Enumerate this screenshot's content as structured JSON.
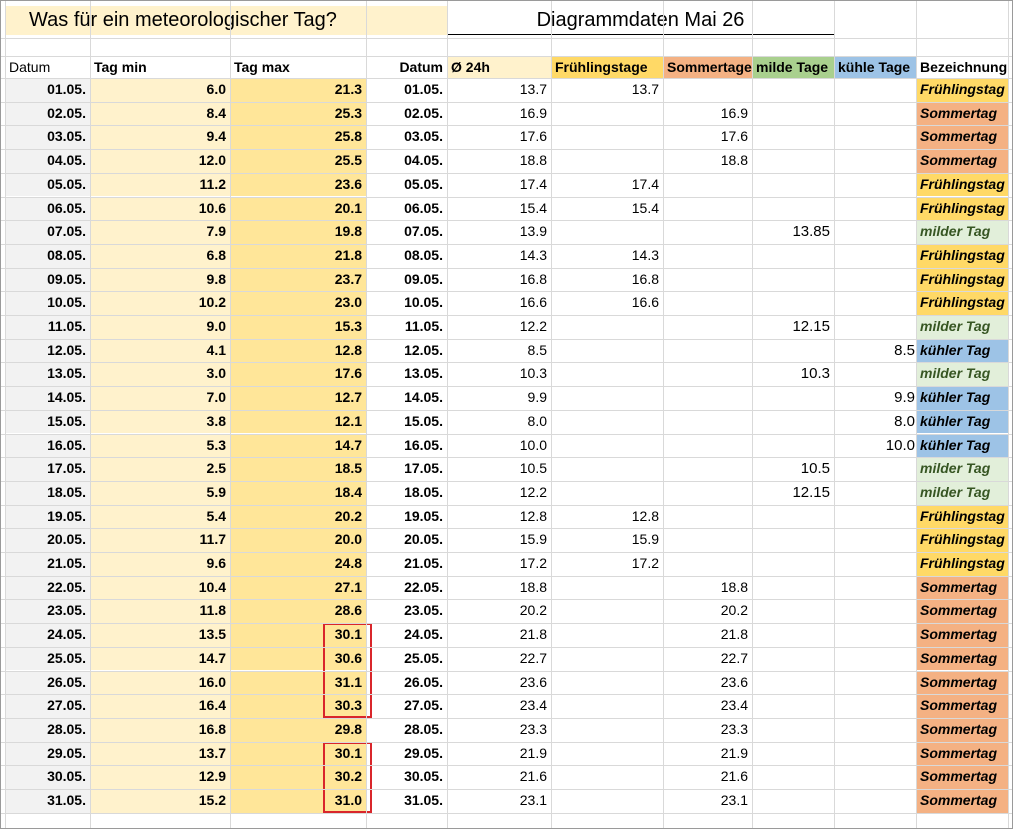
{
  "titles": {
    "left": "Was für ein meteorologischer Tag?",
    "right": "Diagrammdaten Mai 26"
  },
  "headers": {
    "datum": "Datum",
    "tag_min": "Tag min",
    "tag_max": "Tag max",
    "datum2": "Datum",
    "avg24": "Ø 24h",
    "fruehling": "Frühlingstage",
    "sommer": "Sommertage",
    "milde": "milde Tage",
    "kuehle": "kühle Tage",
    "bezeichnung": "Bezeichnung"
  },
  "colors": {
    "light_yellow": "#fff2cc",
    "tag_max_fill": "#ffe699",
    "light_gray": "#f2f2f2",
    "fruehling": "#ffd966",
    "sommer": "#f4b183",
    "milde": "#e2efda",
    "kuehle": "#9dc3e6",
    "milde_header": "#a9d08e",
    "highlight_border": "#d9262b"
  },
  "highlights": [
    {
      "from_row": 23,
      "to_row": 26
    },
    {
      "from_row": 28,
      "to_row": 30
    }
  ],
  "rows": [
    {
      "date": "01.05.",
      "min": "6.0",
      "max": "21.3",
      "avg": "13.7",
      "fr": "13.7",
      "so": "",
      "mi": "",
      "ku": "",
      "label": "Frühlingstag",
      "kind": "fruehling"
    },
    {
      "date": "02.05.",
      "min": "8.4",
      "max": "25.3",
      "avg": "16.9",
      "fr": "",
      "so": "16.9",
      "mi": "",
      "ku": "",
      "label": "Sommertag",
      "kind": "sommer"
    },
    {
      "date": "03.05.",
      "min": "9.4",
      "max": "25.8",
      "avg": "17.6",
      "fr": "",
      "so": "17.6",
      "mi": "",
      "ku": "",
      "label": "Sommertag",
      "kind": "sommer"
    },
    {
      "date": "04.05.",
      "min": "12.0",
      "max": "25.5",
      "avg": "18.8",
      "fr": "",
      "so": "18.8",
      "mi": "",
      "ku": "",
      "label": "Sommertag",
      "kind": "sommer"
    },
    {
      "date": "05.05.",
      "min": "11.2",
      "max": "23.6",
      "avg": "17.4",
      "fr": "17.4",
      "so": "",
      "mi": "",
      "ku": "",
      "label": "Frühlingstag",
      "kind": "fruehling"
    },
    {
      "date": "06.05.",
      "min": "10.6",
      "max": "20.1",
      "avg": "15.4",
      "fr": "15.4",
      "so": "",
      "mi": "",
      "ku": "",
      "label": "Frühlingstag",
      "kind": "fruehling"
    },
    {
      "date": "07.05.",
      "min": "7.9",
      "max": "19.8",
      "avg": "13.9",
      "fr": "",
      "so": "",
      "mi": "13.85",
      "ku": "",
      "label": "milder Tag",
      "kind": "milde"
    },
    {
      "date": "08.05.",
      "min": "6.8",
      "max": "21.8",
      "avg": "14.3",
      "fr": "14.3",
      "so": "",
      "mi": "",
      "ku": "",
      "label": "Frühlingstag",
      "kind": "fruehling"
    },
    {
      "date": "09.05.",
      "min": "9.8",
      "max": "23.7",
      "avg": "16.8",
      "fr": "16.8",
      "so": "",
      "mi": "",
      "ku": "",
      "label": "Frühlingstag",
      "kind": "fruehling"
    },
    {
      "date": "10.05.",
      "min": "10.2",
      "max": "23.0",
      "avg": "16.6",
      "fr": "16.6",
      "so": "",
      "mi": "",
      "ku": "",
      "label": "Frühlingstag",
      "kind": "fruehling"
    },
    {
      "date": "11.05.",
      "min": "9.0",
      "max": "15.3",
      "avg": "12.2",
      "fr": "",
      "so": "",
      "mi": "12.15",
      "ku": "",
      "label": "milder Tag",
      "kind": "milde"
    },
    {
      "date": "12.05.",
      "min": "4.1",
      "max": "12.8",
      "avg": "8.5",
      "fr": "",
      "so": "",
      "mi": "",
      "ku": "8.5",
      "label": "kühler Tag",
      "kind": "kuehle"
    },
    {
      "date": "13.05.",
      "min": "3.0",
      "max": "17.6",
      "avg": "10.3",
      "fr": "",
      "so": "",
      "mi": "10.3",
      "ku": "",
      "label": "milder Tag",
      "kind": "milde"
    },
    {
      "date": "14.05.",
      "min": "7.0",
      "max": "12.7",
      "avg": "9.9",
      "fr": "",
      "so": "",
      "mi": "",
      "ku": "9.9",
      "label": "kühler Tag",
      "kind": "kuehle"
    },
    {
      "date": "15.05.",
      "min": "3.8",
      "max": "12.1",
      "avg": "8.0",
      "fr": "",
      "so": "",
      "mi": "",
      "ku": "8.0",
      "label": "kühler Tag",
      "kind": "kuehle"
    },
    {
      "date": "16.05.",
      "min": "5.3",
      "max": "14.7",
      "avg": "10.0",
      "fr": "",
      "so": "",
      "mi": "",
      "ku": "10.0",
      "label": "kühler Tag",
      "kind": "kuehle"
    },
    {
      "date": "17.05.",
      "min": "2.5",
      "max": "18.5",
      "avg": "10.5",
      "fr": "",
      "so": "",
      "mi": "10.5",
      "ku": "",
      "label": "milder Tag",
      "kind": "milde"
    },
    {
      "date": "18.05.",
      "min": "5.9",
      "max": "18.4",
      "avg": "12.2",
      "fr": "",
      "so": "",
      "mi": "12.15",
      "ku": "",
      "label": "milder Tag",
      "kind": "milde"
    },
    {
      "date": "19.05.",
      "min": "5.4",
      "max": "20.2",
      "avg": "12.8",
      "fr": "12.8",
      "so": "",
      "mi": "",
      "ku": "",
      "label": "Frühlingstag",
      "kind": "fruehling"
    },
    {
      "date": "20.05.",
      "min": "11.7",
      "max": "20.0",
      "avg": "15.9",
      "fr": "15.9",
      "so": "",
      "mi": "",
      "ku": "",
      "label": "Frühlingstag",
      "kind": "fruehling"
    },
    {
      "date": "21.05.",
      "min": "9.6",
      "max": "24.8",
      "avg": "17.2",
      "fr": "17.2",
      "so": "",
      "mi": "",
      "ku": "",
      "label": "Frühlingstag",
      "kind": "fruehling"
    },
    {
      "date": "22.05.",
      "min": "10.4",
      "max": "27.1",
      "avg": "18.8",
      "fr": "",
      "so": "18.8",
      "mi": "",
      "ku": "",
      "label": "Sommertag",
      "kind": "sommer"
    },
    {
      "date": "23.05.",
      "min": "11.8",
      "max": "28.6",
      "avg": "20.2",
      "fr": "",
      "so": "20.2",
      "mi": "",
      "ku": "",
      "label": "Sommertag",
      "kind": "sommer"
    },
    {
      "date": "24.05.",
      "min": "13.5",
      "max": "30.1",
      "avg": "21.8",
      "fr": "",
      "so": "21.8",
      "mi": "",
      "ku": "",
      "label": "Sommertag",
      "kind": "sommer"
    },
    {
      "date": "25.05.",
      "min": "14.7",
      "max": "30.6",
      "avg": "22.7",
      "fr": "",
      "so": "22.7",
      "mi": "",
      "ku": "",
      "label": "Sommertag",
      "kind": "sommer"
    },
    {
      "date": "26.05.",
      "min": "16.0",
      "max": "31.1",
      "avg": "23.6",
      "fr": "",
      "so": "23.6",
      "mi": "",
      "ku": "",
      "label": "Sommertag",
      "kind": "sommer"
    },
    {
      "date": "27.05.",
      "min": "16.4",
      "max": "30.3",
      "avg": "23.4",
      "fr": "",
      "so": "23.4",
      "mi": "",
      "ku": "",
      "label": "Sommertag",
      "kind": "sommer"
    },
    {
      "date": "28.05.",
      "min": "16.8",
      "max": "29.8",
      "avg": "23.3",
      "fr": "",
      "so": "23.3",
      "mi": "",
      "ku": "",
      "label": "Sommertag",
      "kind": "sommer"
    },
    {
      "date": "29.05.",
      "min": "13.7",
      "max": "30.1",
      "avg": "21.9",
      "fr": "",
      "so": "21.9",
      "mi": "",
      "ku": "",
      "label": "Sommertag",
      "kind": "sommer"
    },
    {
      "date": "30.05.",
      "min": "12.9",
      "max": "30.2",
      "avg": "21.6",
      "fr": "",
      "so": "21.6",
      "mi": "",
      "ku": "",
      "label": "Sommertag",
      "kind": "sommer"
    },
    {
      "date": "31.05.",
      "min": "15.2",
      "max": "31.0",
      "avg": "23.1",
      "fr": "",
      "so": "23.1",
      "mi": "",
      "ku": "",
      "label": "Sommertag",
      "kind": "sommer"
    }
  ]
}
